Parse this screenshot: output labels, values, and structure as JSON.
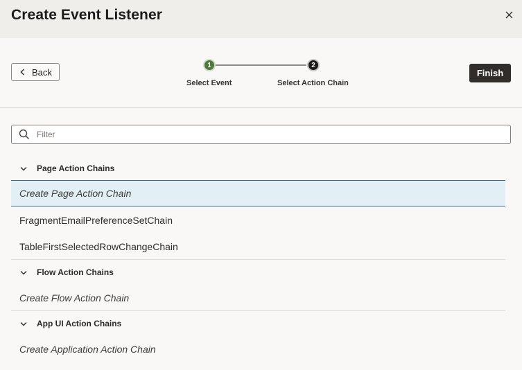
{
  "dialog": {
    "title": "Create Event Listener"
  },
  "toolbar": {
    "back_label": "Back",
    "finish_label": "Finish",
    "steps": [
      {
        "number": "1",
        "label": "Select Event",
        "status": "completed",
        "color": "#4b7a3a"
      },
      {
        "number": "2",
        "label": "Select Action Chain",
        "status": "current",
        "color": "#1c1a18"
      }
    ]
  },
  "filter": {
    "placeholder": "Filter",
    "value": ""
  },
  "groups": [
    {
      "label": "Page Action Chains",
      "expanded": true,
      "items": [
        {
          "label": "Create Page Action Chain",
          "italic": true,
          "selected": true
        },
        {
          "label": "FragmentEmailPreferenceSetChain",
          "italic": false,
          "selected": false
        },
        {
          "label": "TableFirstSelectedRowChangeChain",
          "italic": false,
          "selected": false
        }
      ]
    },
    {
      "label": "Flow Action Chains",
      "expanded": true,
      "items": [
        {
          "label": "Create Flow Action Chain",
          "italic": true,
          "selected": false
        }
      ]
    },
    {
      "label": "App UI Action Chains",
      "expanded": true,
      "items": [
        {
          "label": "Create Application Action Chain",
          "italic": true,
          "selected": false
        }
      ]
    }
  ],
  "icons": {
    "close": "close-icon",
    "back": "chevron-left-icon",
    "search": "search-icon",
    "expand": "chevron-down-icon"
  },
  "colors": {
    "accent_selected_bg": "#e2eff5",
    "accent_selected_border": "#3d6e84",
    "primary_button": "#312d2a"
  }
}
